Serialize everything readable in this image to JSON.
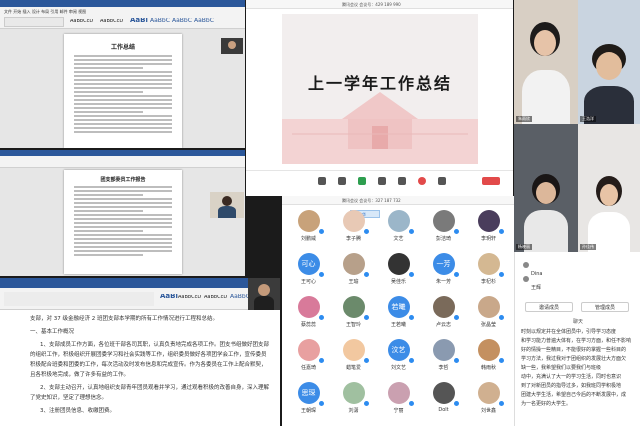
{
  "word_top": {
    "title": "工作总结",
    "ribbon_styles": [
      "AaBbCcD",
      "AaBbCcD",
      "AaBl",
      "AaBbC",
      "AaBbC",
      "AaBbC"
    ]
  },
  "word_mid": {
    "title": "团支部委员工作报告"
  },
  "word_bottom": {
    "ribbon_styles": [
      "AaBl",
      "AaBbCcD",
      "AaBbCcD",
      "AaBbC",
      "AaBbC",
      "AaBbC",
      "AaBbC"
    ],
    "paragraphs": [
      "支部，对 37 级金融经济 2 班团支部本学期的所有工作情况进行工程和总结。",
      "一、基本工作概况",
      "1、支部成员工作方面，各位班干部各司其职，认真负责地完成各项工作。团支书组做好团支部的组织工作，积极组织开展团委学习和社会实践等工作，组织委员做好各项团学会工作，宣传委员积极配合班委和团委的工作，每次活动及时发布信息和完成宣传。作为各委员在工作上配合默契，且各积极地完成，做了许多有益的工作。",
      "2、支部主动召开，认真地组织支部青年团员观看并学习，通过观看积极的改善自身，深入理解了党史知识，坚定了理想信念。",
      "3、注册团员信息、收缴团费。"
    ]
  },
  "meeting": {
    "top_bar_text": "腾讯会议 会议号：429 189 990",
    "slide_title": "上一学年工作总结",
    "grid_bar_text": "腾讯会议 会议号：327 187 732",
    "speaker_tag": "王文华"
  },
  "participants": [
    {
      "name": "刘鹏威",
      "kind": "photo",
      "color": "#c8a27a"
    },
    {
      "name": "李子腾",
      "kind": "photo",
      "color": "#e8c9b5"
    },
    {
      "name": "文艺",
      "kind": "photo",
      "color": "#9bb6c9"
    },
    {
      "name": "彭洁琦",
      "kind": "photo",
      "color": "#7a7a7a"
    },
    {
      "name": "李玥轩",
      "kind": "photo",
      "color": "#4a3d5c"
    },
    {
      "name": "王可心",
      "kind": "text",
      "text": "可心",
      "color": "#3c8ce7"
    },
    {
      "name": "王瑜",
      "kind": "photo",
      "color": "#b7a08a"
    },
    {
      "name": "吴佳乐",
      "kind": "photo",
      "color": "#333333"
    },
    {
      "name": "朱一芳",
      "kind": "text",
      "text": "一芳",
      "color": "#3c8ce7"
    },
    {
      "name": "李杞杉",
      "kind": "photo",
      "color": "#d4b892"
    },
    {
      "name": "蔡蕊蕊",
      "kind": "photo",
      "color": "#d87a9a"
    },
    {
      "name": "王智玲",
      "kind": "photo",
      "color": "#6b8a6b"
    },
    {
      "name": "王若曦",
      "kind": "text",
      "text": "若曦",
      "color": "#3c8ce7"
    },
    {
      "name": "卢云志",
      "kind": "photo",
      "color": "#7a6a5a"
    },
    {
      "name": "张晶莹",
      "kind": "photo",
      "color": "#c9a88a"
    },
    {
      "name": "任嘉琦",
      "kind": "photo",
      "color": "#e8a0a0"
    },
    {
      "name": "蜡笔爱",
      "kind": "photo",
      "color": "#f2c8a0"
    },
    {
      "name": "刘文艺",
      "kind": "text",
      "text": "汶艺",
      "color": "#3c8ce7"
    },
    {
      "name": "李哲",
      "kind": "photo",
      "color": "#8a9ab0"
    },
    {
      "name": "韩雨秋",
      "kind": "photo",
      "color": "#c49060"
    },
    {
      "name": "王朝琛",
      "kind": "text",
      "text": "思琛",
      "color": "#3c8ce7"
    },
    {
      "name": "刘潇",
      "kind": "photo",
      "color": "#a0c0a0"
    },
    {
      "name": "宁丽",
      "kind": "photo",
      "color": "#caa0b0"
    },
    {
      "name": "Dolt",
      "kind": "photo",
      "color": "#555555"
    },
    {
      "name": "刘世鑫",
      "kind": "photo",
      "color": "#d0b090"
    }
  ],
  "cams": [
    {
      "label": "朱雨欣"
    },
    {
      "label": "王浩洋"
    },
    {
      "label": "杨晓丽"
    },
    {
      "label": "孙佳伟"
    }
  ],
  "chat": {
    "items": [
      "Dina",
      "王辉"
    ],
    "buttons": [
      "邀请成员",
      "管理成员"
    ],
    "panel_title": "聊天"
  },
  "right_text": [
    "时刻以规定并在全体团员中，引导学习态度",
    "和学习能力普遍大体有，在学习方面，和任不影响",
    "好的情操一些精目，不能很好的掌握一些科目的",
    "学习方法，我过我对于团组织的发展壮大方面欠",
    "缺一些，我希望我们以要我们与班级",
    "动中，充满认了大一的学习生活，同时也意识",
    "到了对新团员的指导过多，如我班同学积极地",
    "团建大学生活，希望自己今后的不断发展中，成",
    "为一名更好的大学生。"
  ]
}
